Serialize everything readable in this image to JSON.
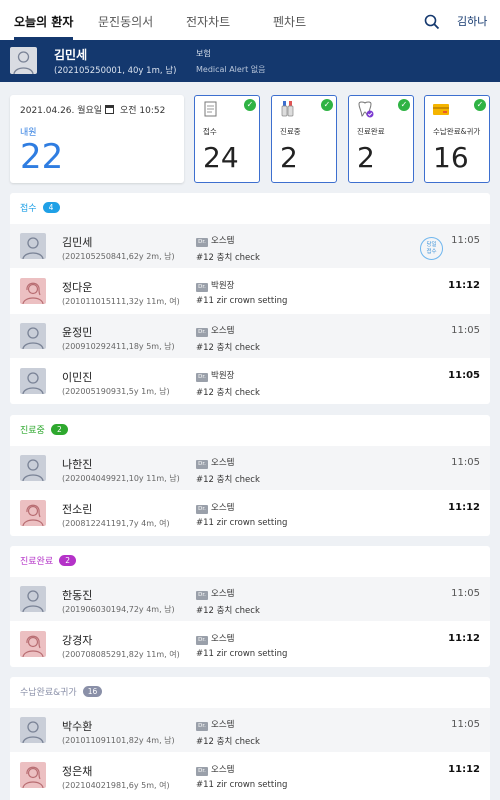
{
  "nav": {
    "tabs": [
      "오늘의 환자",
      "문진동의서",
      "전자차트",
      "펜차트"
    ],
    "user": "김하나"
  },
  "banner": {
    "name": "김민세",
    "detail": "(202105250001, 40y 1m, 남)",
    "insurance": "보험",
    "alert": "Medical Alert 없음"
  },
  "summary": {
    "date": "2021.04.26. 월요일",
    "time": "오전 10:52",
    "inbound_label": "내원",
    "inbound_value": "22",
    "cards": [
      {
        "label": "접수",
        "value": "24",
        "icon": "clipboard-icon"
      },
      {
        "label": "진료중",
        "value": "2",
        "icon": "dental-tools-icon"
      },
      {
        "label": "진료완료",
        "value": "2",
        "icon": "tooth-check-icon"
      },
      {
        "label": "수납완료&귀가",
        "value": "16",
        "icon": "payment-card-icon"
      }
    ]
  },
  "colors": {
    "primary": "#14386e",
    "card_border": "#3d6fcf",
    "reception": "#1fa0e6",
    "in_treatment": "#2ea82e",
    "treatment_done": "#b432c8",
    "paid": "#8a90a8"
  },
  "sections": [
    {
      "title": "접수",
      "count": "4",
      "rows": [
        {
          "name": "김민세",
          "detail": "(202105250841,62y 2m, 남)",
          "doctor": "오스템",
          "note": "#12 충치 check",
          "time": "11:05",
          "gender": "m",
          "same_day": "당일\n접수"
        },
        {
          "name": "정다운",
          "detail": "(201011015111,32y 11m, 여)",
          "doctor": "박원장",
          "note": "#11 zir crown setting",
          "time": "11:12",
          "gender": "f"
        },
        {
          "name": "윤정민",
          "detail": "(200910292411,18y 5m, 남)",
          "doctor": "오스템",
          "note": "#12 충치 check",
          "time": "11:05",
          "gender": "m"
        },
        {
          "name": "이민진",
          "detail": "(202005190931,5y 1m, 남)",
          "doctor": "박원장",
          "note": "#12 충치 check",
          "time": "11:05",
          "gender": "m"
        }
      ]
    },
    {
      "title": "진료중",
      "count": "2",
      "rows": [
        {
          "name": "나한진",
          "detail": "(202004049921,10y 11m, 남)",
          "doctor": "오스템",
          "note": "#12 충치 check",
          "time": "11:05",
          "gender": "m"
        },
        {
          "name": "전소린",
          "detail": "(200812241191,7y 4m, 여)",
          "doctor": "오스템",
          "note": "#11 zir crown setting",
          "time": "11:12",
          "gender": "f"
        }
      ]
    },
    {
      "title": "진료완료",
      "count": "2",
      "rows": [
        {
          "name": "한동진",
          "detail": "(201906030194,72y 4m, 남)",
          "doctor": "오스템",
          "note": "#12 충치 check",
          "time": "11:05",
          "gender": "m"
        },
        {
          "name": "강경자",
          "detail": "(200708085291,82y 11m, 여)",
          "doctor": "오스템",
          "note": "#11 zir crown setting",
          "time": "11:12",
          "gender": "f"
        }
      ]
    },
    {
      "title": "수납완료&귀가",
      "count": "16",
      "rows": [
        {
          "name": "박수환",
          "detail": "(201011091101,82y 4m, 남)",
          "doctor": "오스템",
          "note": "#12 충치 check",
          "time": "11:05",
          "gender": "m"
        },
        {
          "name": "정은채",
          "detail": "(202104021981,6y 5m, 여)",
          "doctor": "오스템",
          "note": "#11 zir crown setting",
          "time": "11:12",
          "gender": "f"
        }
      ]
    }
  ]
}
